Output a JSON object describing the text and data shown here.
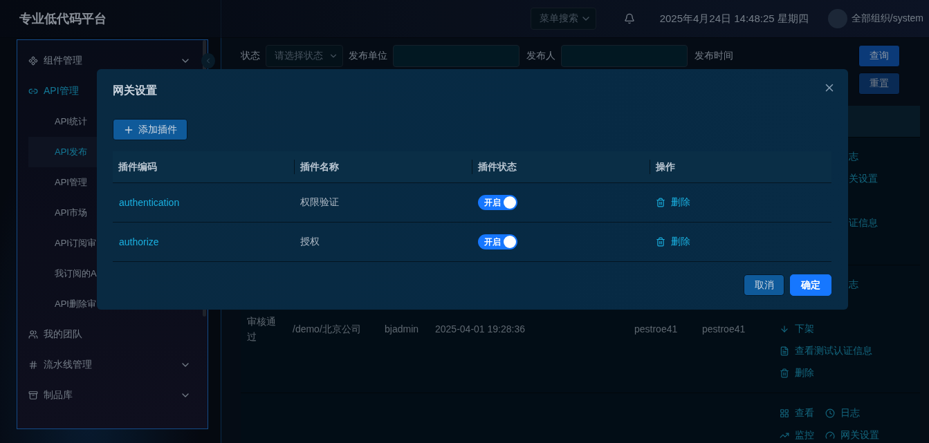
{
  "header": {
    "logo": "专业低代码平台",
    "menu_search": {
      "placeholder": "菜单搜索"
    },
    "datetime": "2025年4月24日 14:48:25 星期四",
    "user": "全部组织/system"
  },
  "sidebar": {
    "items": [
      {
        "label": "组件管理",
        "selected": false,
        "expanded": false,
        "has_submenu": true
      },
      {
        "label": "API管理",
        "selected": true,
        "expanded": true,
        "has_submenu": false,
        "children": [
          {
            "label": "API统计",
            "selected": false
          },
          {
            "label": "API发布",
            "selected": true
          },
          {
            "label": "API管理",
            "selected": false
          },
          {
            "label": "API市场",
            "selected": false
          },
          {
            "label": "API订阅审",
            "selected": false
          },
          {
            "label": "我订阅的A",
            "selected": false
          },
          {
            "label": "API删除审",
            "selected": false
          }
        ]
      },
      {
        "label": "我的团队",
        "selected": false,
        "expanded": false,
        "has_submenu": false
      },
      {
        "label": "流水线管理",
        "selected": false,
        "expanded": false,
        "has_submenu": true
      },
      {
        "label": "制品库",
        "selected": false,
        "expanded": false,
        "has_submenu": true
      }
    ]
  },
  "filters": [
    {
      "label": "状态",
      "kind": "select",
      "placeholder": "请选择状态"
    },
    {
      "label": "发布单位",
      "kind": "input"
    },
    {
      "label": "发布人",
      "kind": "input"
    },
    {
      "label": "发布时间",
      "kind": "label"
    }
  ],
  "filter_buttons": [
    {
      "label": "查询",
      "kind": "primary"
    },
    {
      "label": "重置",
      "kind": "secondary"
    }
  ],
  "table": {
    "rows": [
      {
        "actions": [
          {
            "kind": "links",
            "items": [
              {
                "kind": "partial",
                "label": "志"
              }
            ]
          },
          {
            "kind": "links",
            "items": [
              {
                "kind": "partial",
                "label": "关设置"
              }
            ]
          },
          {
            "kind": "covered"
          },
          {
            "kind": "links",
            "items": [
              {
                "kind": "partial",
                "label": "证信息"
              }
            ]
          },
          {
            "kind": "covered"
          }
        ]
      },
      {
        "cells": [
          "审核通过",
          "/demo/北京公司",
          "bjadmin",
          "2025-04-01 19:28:36",
          "pestroe41",
          "pestroe41"
        ],
        "actions": [
          {
            "kind": "links",
            "items": [
              {
                "kind": "partial",
                "label": "志"
              }
            ]
          },
          {
            "kind": "covered"
          },
          {
            "kind": "links",
            "items": [
              {
                "kind": "offline",
                "label": "下架"
              }
            ]
          },
          {
            "kind": "links",
            "items": [
              {
                "kind": "credential",
                "label": "查看测试认证信息"
              }
            ]
          },
          {
            "kind": "links",
            "items": [
              {
                "kind": "delete",
                "label": "删除"
              }
            ]
          }
        ]
      },
      {
        "actions": [
          {
            "kind": "links",
            "items": [
              {
                "kind": "view",
                "label": "查看"
              },
              {
                "kind": "log",
                "label": "日志"
              }
            ]
          },
          {
            "kind": "links",
            "items": [
              {
                "kind": "monitor",
                "label": "监控"
              },
              {
                "kind": "gateway",
                "label": "网关设置"
              }
            ]
          }
        ]
      }
    ]
  },
  "modal": {
    "title": "网关设置",
    "add_button": "添加插件",
    "columns": [
      "插件编码",
      "插件名称",
      "插件状态",
      "操作"
    ],
    "plugins": [
      {
        "code": "authentication",
        "name": "权限验证",
        "enabled": true,
        "status_label": "开启",
        "action": "删除"
      },
      {
        "code": "authorize",
        "name": "授权",
        "enabled": true,
        "status_label": "开启",
        "action": "删除"
      }
    ],
    "buttons": [
      {
        "label": "取消",
        "kind": "secondary"
      },
      {
        "label": "确定",
        "kind": "primary"
      }
    ]
  }
}
